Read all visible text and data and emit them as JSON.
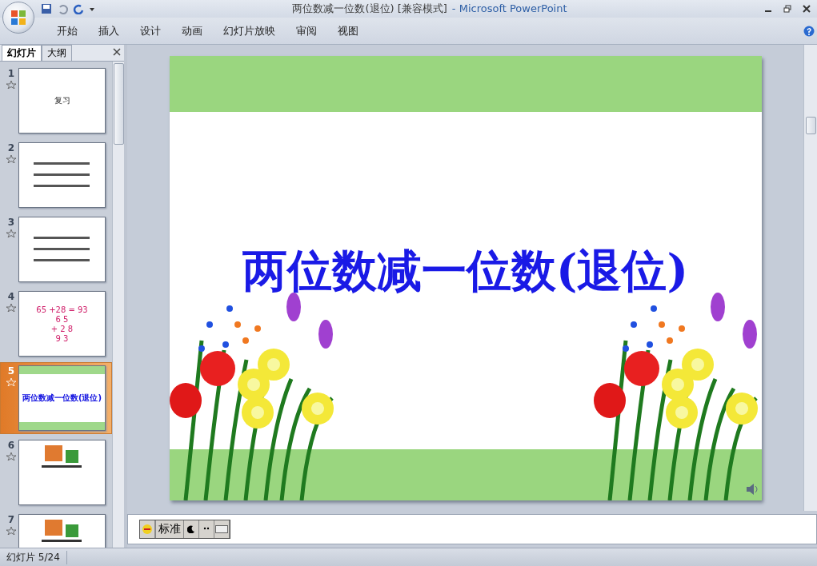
{
  "window": {
    "document_title": "两位数减一位数(退位) [兼容模式]",
    "app_name": "- Microsoft PowerPoint"
  },
  "ribbon_tabs": [
    {
      "label": "开始"
    },
    {
      "label": "插入"
    },
    {
      "label": "设计"
    },
    {
      "label": "动画"
    },
    {
      "label": "幻灯片放映"
    },
    {
      "label": "审阅"
    },
    {
      "label": "视图"
    }
  ],
  "panel_tabs": [
    {
      "label": "幻灯片",
      "selected": true
    },
    {
      "label": "大纲",
      "selected": false
    }
  ],
  "slides": [
    {
      "number": "1",
      "selected": false,
      "kind": "text",
      "texts": [
        "复习"
      ]
    },
    {
      "number": "2",
      "selected": false,
      "kind": "text"
    },
    {
      "number": "3",
      "selected": false,
      "kind": "text"
    },
    {
      "number": "4",
      "selected": false,
      "kind": "text",
      "texts": [
        "65 +28 = 93",
        "6 5",
        "+ 2 8",
        "9 3"
      ]
    },
    {
      "number": "5",
      "selected": true,
      "kind": "title",
      "texts": [
        "两位数减一位数(退位)"
      ]
    },
    {
      "number": "6",
      "selected": false,
      "kind": "picture"
    },
    {
      "number": "7",
      "selected": false,
      "kind": "picture"
    }
  ],
  "slide": {
    "title": "两位数减一位数(退位)"
  },
  "ime_toolbar": {
    "mode": "标准"
  },
  "status_bar": {
    "slide_info": "幻灯片 5/24"
  }
}
